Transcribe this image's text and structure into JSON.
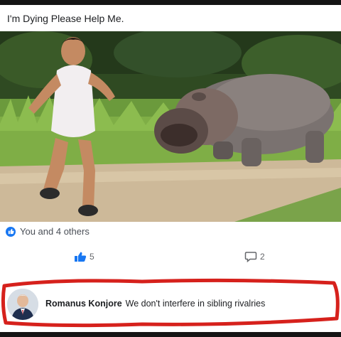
{
  "post": {
    "text": "I'm Dying Please Help Me."
  },
  "photo": {
    "subject": "man-running-from-hippo-photo"
  },
  "reactions": {
    "summary": "You and 4 others",
    "icon": "like-reaction-icon",
    "accent": "#1877f2"
  },
  "actions": {
    "like_count": "5",
    "comment_count": "2"
  },
  "comment": {
    "author": "Romanus Konjore",
    "text": "We don't interfere in sibling rivalries",
    "highlight_color": "#d6211c"
  }
}
